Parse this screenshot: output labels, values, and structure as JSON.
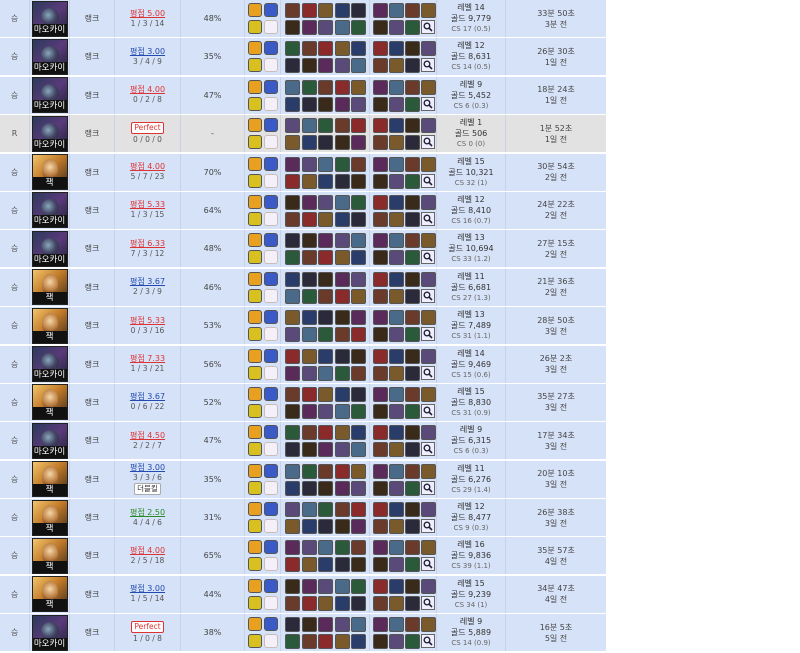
{
  "matches": [
    {
      "result": "승",
      "champion": "마오카이",
      "mode": "랭크",
      "kda_avg": "평점 5.00",
      "kda_color": "red",
      "kda_detail": "1 / 3 / 14",
      "badge": "",
      "pct": "48%",
      "level": "레벨 14",
      "gold": "골드 9,779",
      "cs": "CS 17 (0.5)",
      "duration": "33분 50초",
      "ago": "3분 전"
    },
    {
      "result": "승",
      "champion": "마오카이",
      "mode": "랭크",
      "kda_avg": "평점 3.00",
      "kda_color": "blue",
      "kda_detail": "3 / 4 / 9",
      "badge": "",
      "pct": "35%",
      "level": "레벨 12",
      "gold": "골드 8,631",
      "cs": "CS 14 (0.5)",
      "duration": "26분 30초",
      "ago": "1일 전"
    },
    {
      "result": "승",
      "champion": "마오카이",
      "mode": "랭크",
      "kda_avg": "평점 4.00",
      "kda_color": "red",
      "kda_detail": "0 / 2 / 8",
      "badge": "",
      "pct": "47%",
      "level": "레벨 9",
      "gold": "골드 5,452",
      "cs": "CS 6 (0.3)",
      "duration": "18분 24초",
      "ago": "1일 전"
    },
    {
      "result": "R",
      "champion": "마오카이",
      "mode": "랭크",
      "kda_avg": "",
      "kda_color": "",
      "kda_detail": "0 / 0 / 0",
      "badge": "Perfect",
      "pct": "-",
      "level": "레벨 1",
      "gold": "골드 506",
      "cs": "CS 0 (0)",
      "duration": "1분 52초",
      "ago": "1일 전"
    },
    {
      "result": "승",
      "champion": "잭",
      "mode": "랭크",
      "kda_avg": "평점 4.00",
      "kda_color": "red",
      "kda_detail": "5 / 7 / 23",
      "badge": "",
      "pct": "70%",
      "level": "레벨 15",
      "gold": "골드 10,321",
      "cs": "CS 32 (1)",
      "duration": "30분 54초",
      "ago": "2일 전"
    },
    {
      "result": "승",
      "champion": "마오카이",
      "mode": "랭크",
      "kda_avg": "평점 5.33",
      "kda_color": "red",
      "kda_detail": "1 / 3 / 15",
      "badge": "",
      "pct": "64%",
      "level": "레벨 12",
      "gold": "골드 8,410",
      "cs": "CS 16 (0.7)",
      "duration": "24분 22초",
      "ago": "2일 전"
    },
    {
      "result": "승",
      "champion": "마오카이",
      "mode": "랭크",
      "kda_avg": "평점 6.33",
      "kda_color": "red",
      "kda_detail": "7 / 3 / 12",
      "badge": "",
      "pct": "48%",
      "level": "레벨 13",
      "gold": "골드 10,694",
      "cs": "CS 33 (1.2)",
      "duration": "27분 15초",
      "ago": "2일 전"
    },
    {
      "result": "승",
      "champion": "잭",
      "mode": "랭크",
      "kda_avg": "평점 3.67",
      "kda_color": "blue",
      "kda_detail": "2 / 3 / 9",
      "badge": "",
      "pct": "46%",
      "level": "레벨 11",
      "gold": "골드 6,681",
      "cs": "CS 27 (1.3)",
      "duration": "21분 36초",
      "ago": "2일 전"
    },
    {
      "result": "승",
      "champion": "잭",
      "mode": "랭크",
      "kda_avg": "평점 5.33",
      "kda_color": "red",
      "kda_detail": "0 / 3 / 16",
      "badge": "",
      "pct": "53%",
      "level": "레벨 13",
      "gold": "골드 7,489",
      "cs": "CS 31 (1.1)",
      "duration": "28분 50초",
      "ago": "3일 전"
    },
    {
      "result": "승",
      "champion": "마오카이",
      "mode": "랭크",
      "kda_avg": "평점 7.33",
      "kda_color": "red",
      "kda_detail": "1 / 3 / 21",
      "badge": "",
      "pct": "56%",
      "level": "레벨 14",
      "gold": "골드 9,469",
      "cs": "CS 15 (0.6)",
      "duration": "26분 2초",
      "ago": "3일 전"
    },
    {
      "result": "승",
      "champion": "잭",
      "mode": "랭크",
      "kda_avg": "평점 3.67",
      "kda_color": "blue",
      "kda_detail": "0 / 6 / 22",
      "badge": "",
      "pct": "52%",
      "level": "레벨 15",
      "gold": "골드 8,830",
      "cs": "CS 31 (0.9)",
      "duration": "35분 27초",
      "ago": "3일 전"
    },
    {
      "result": "승",
      "champion": "마오카이",
      "mode": "랭크",
      "kda_avg": "평점 4.50",
      "kda_color": "red",
      "kda_detail": "2 / 2 / 7",
      "badge": "",
      "pct": "47%",
      "level": "레벨 9",
      "gold": "골드 6,315",
      "cs": "CS 6 (0.3)",
      "duration": "17분 34초",
      "ago": "3일 전"
    },
    {
      "result": "승",
      "champion": "잭",
      "mode": "랭크",
      "kda_avg": "평점 3.00",
      "kda_color": "blue",
      "kda_detail": "3 / 3 / 6",
      "badge": "더블킬",
      "pct": "35%",
      "level": "레벨 11",
      "gold": "골드 6,276",
      "cs": "CS 29 (1.4)",
      "duration": "20분 10초",
      "ago": "3일 전"
    },
    {
      "result": "승",
      "champion": "잭",
      "mode": "랭크",
      "kda_avg": "평점 2.50",
      "kda_color": "green",
      "kda_detail": "4 / 4 / 6",
      "badge": "",
      "pct": "31%",
      "level": "레벨 12",
      "gold": "골드 8,477",
      "cs": "CS 9 (0.3)",
      "duration": "26분 38초",
      "ago": "3일 전"
    },
    {
      "result": "승",
      "champion": "잭",
      "mode": "랭크",
      "kda_avg": "평점 4.00",
      "kda_color": "red",
      "kda_detail": "2 / 5 / 18",
      "badge": "",
      "pct": "65%",
      "level": "레벨 16",
      "gold": "골드 9,836",
      "cs": "CS 39 (1.1)",
      "duration": "35분 57초",
      "ago": "4일 전"
    },
    {
      "result": "승",
      "champion": "잭",
      "mode": "랭크",
      "kda_avg": "평점 3.00",
      "kda_color": "blue",
      "kda_detail": "1 / 5 / 14",
      "badge": "",
      "pct": "44%",
      "level": "레벨 15",
      "gold": "골드 9,239",
      "cs": "CS 34 (1)",
      "duration": "34분 47초",
      "ago": "4일 전"
    },
    {
      "result": "승",
      "champion": "마오카이",
      "mode": "랭크",
      "kda_avg": "",
      "kda_color": "",
      "kda_detail": "1 / 0 / 8",
      "badge": "Perfect",
      "pct": "38%",
      "level": "레벨 9",
      "gold": "골드 5,889",
      "cs": "CS 14 (0.9)",
      "duration": "16분 5초",
      "ago": "5일 전"
    }
  ],
  "icon_palette": [
    "#6a3a2a",
    "#2a3d6a",
    "#5a2a5a",
    "#2a5a3a",
    "#7a5a2a",
    "#3a2a1a",
    "#4a6a8a",
    "#8a2a2a",
    "#2a2a3a",
    "#5a4a7a"
  ]
}
